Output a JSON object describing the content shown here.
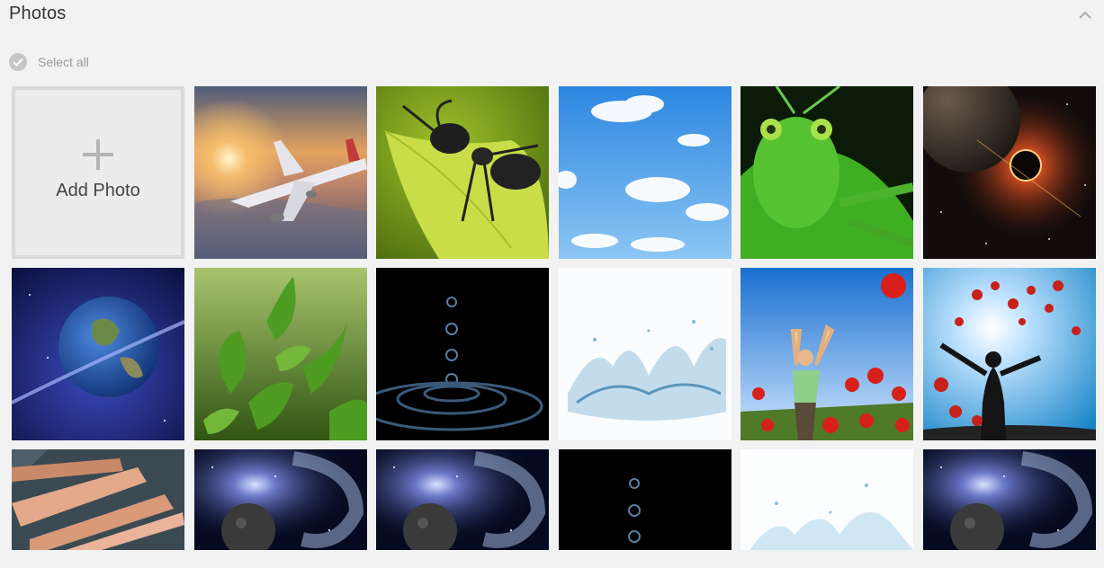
{
  "header": {
    "title": "Photos",
    "collapse_icon": "chevron-up-icon"
  },
  "select_all": {
    "label": "Select all",
    "icon": "check-circle-icon"
  },
  "add_photo": {
    "label": "Add Photo",
    "icon": "plus-icon"
  },
  "photos": [
    {
      "name": "photo-airplane"
    },
    {
      "name": "photo-ant"
    },
    {
      "name": "photo-sky-clouds"
    },
    {
      "name": "photo-grasshopper"
    },
    {
      "name": "photo-planet-eclipse"
    },
    {
      "name": "photo-earth"
    },
    {
      "name": "photo-green-leaves"
    },
    {
      "name": "photo-water-drops"
    },
    {
      "name": "photo-water-splash"
    },
    {
      "name": "photo-girl-poppies"
    },
    {
      "name": "photo-silhouette-poppies"
    },
    {
      "name": "photo-hands"
    },
    {
      "name": "photo-galaxy-planet"
    },
    {
      "name": "photo-galaxy-planet"
    },
    {
      "name": "photo-water-drops"
    },
    {
      "name": "photo-water-splash"
    },
    {
      "name": "photo-galaxy-planet"
    }
  ]
}
